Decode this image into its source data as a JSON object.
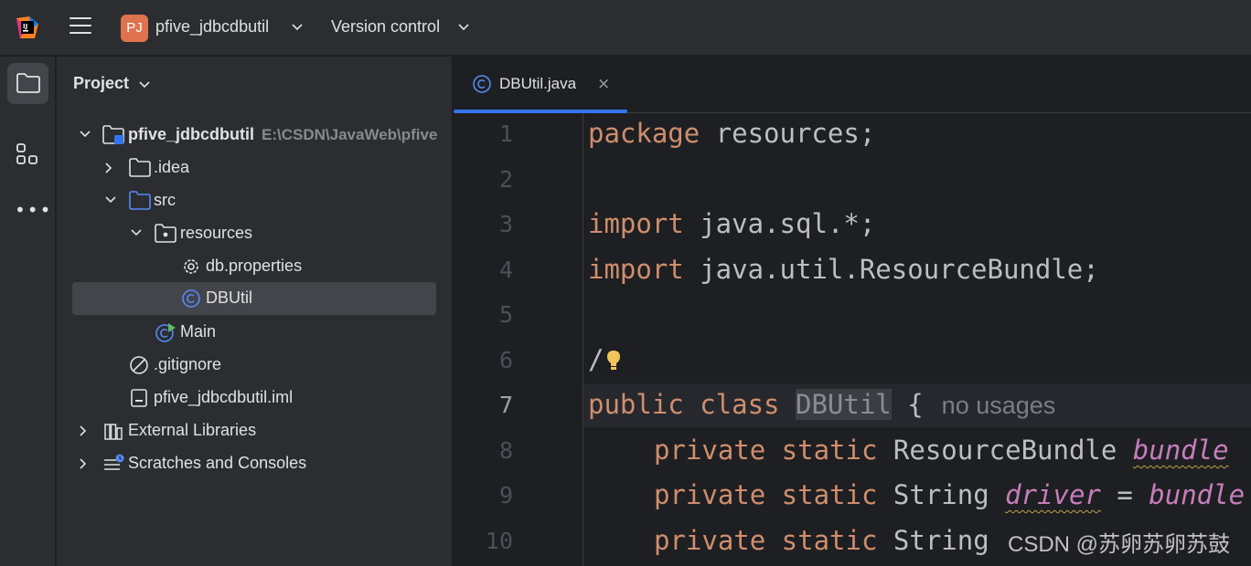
{
  "titlebar": {
    "project_badge": "PJ",
    "project_name": "pfive_jdbcdbutil",
    "version_control": "Version control",
    "badge_color": "#e0734f"
  },
  "toolstrip": {
    "icons": [
      "folder-icon",
      "structure-icon",
      "more-icon"
    ],
    "more_glyph": "•••"
  },
  "project_panel": {
    "title": "Project",
    "tree": [
      {
        "label": "pfive_jdbcdbutil",
        "path": "E:\\CSDN\\JavaWeb\\pfive",
        "icon": "module-folder-icon",
        "expanded": true
      },
      {
        "label": ".idea",
        "icon": "folder-icon",
        "expanded": false
      },
      {
        "label": "src",
        "icon": "source-folder-icon",
        "expanded": true
      },
      {
        "label": "resources",
        "icon": "package-icon",
        "expanded": true
      },
      {
        "label": "db.properties",
        "icon": "properties-icon"
      },
      {
        "label": "DBUtil",
        "icon": "java-class-icon",
        "selected": true
      },
      {
        "label": "Main",
        "icon": "runnable-class-icon"
      },
      {
        "label": ".gitignore",
        "icon": "ignore-file-icon"
      },
      {
        "label": "pfive_jdbcdbutil.iml",
        "icon": "iml-file-icon"
      },
      {
        "label": "External Libraries",
        "icon": "libraries-icon",
        "expanded": false
      },
      {
        "label": "Scratches and Consoles",
        "icon": "scratches-icon",
        "expanded": false
      }
    ]
  },
  "editor": {
    "tab_label": "DBUtil.java",
    "tab_close": "×",
    "accent": "#3574f0",
    "current_line": 7,
    "line_numbers": [
      "1",
      "2",
      "3",
      "4",
      "5",
      "6",
      "7",
      "8",
      "9",
      "10"
    ],
    "code": {
      "l1_kw": "package",
      "l1_rest": " resources;",
      "l3_kw": "import",
      "l3_rest": " java.sql.*;",
      "l4_kw": "import",
      "l4_rest": " java.util.ResourceBundle;",
      "l6_comment": "/",
      "l7_kw": "public class",
      "l7_class": "DBUtil",
      "l7_brace": " {",
      "l7_hint": "no usages",
      "l8_kw": "private static",
      "l8_type": " ResourceBundle ",
      "l8_field": "bundle",
      "l9_kw": "private static",
      "l9_type": " String ",
      "l9_field": "driver",
      "l9_eq": " = ",
      "l9_rhs": "bundle",
      "l10_kw": "private static",
      "l10_type": " String "
    }
  },
  "watermark": "CSDN @苏卵苏卵苏鼓"
}
